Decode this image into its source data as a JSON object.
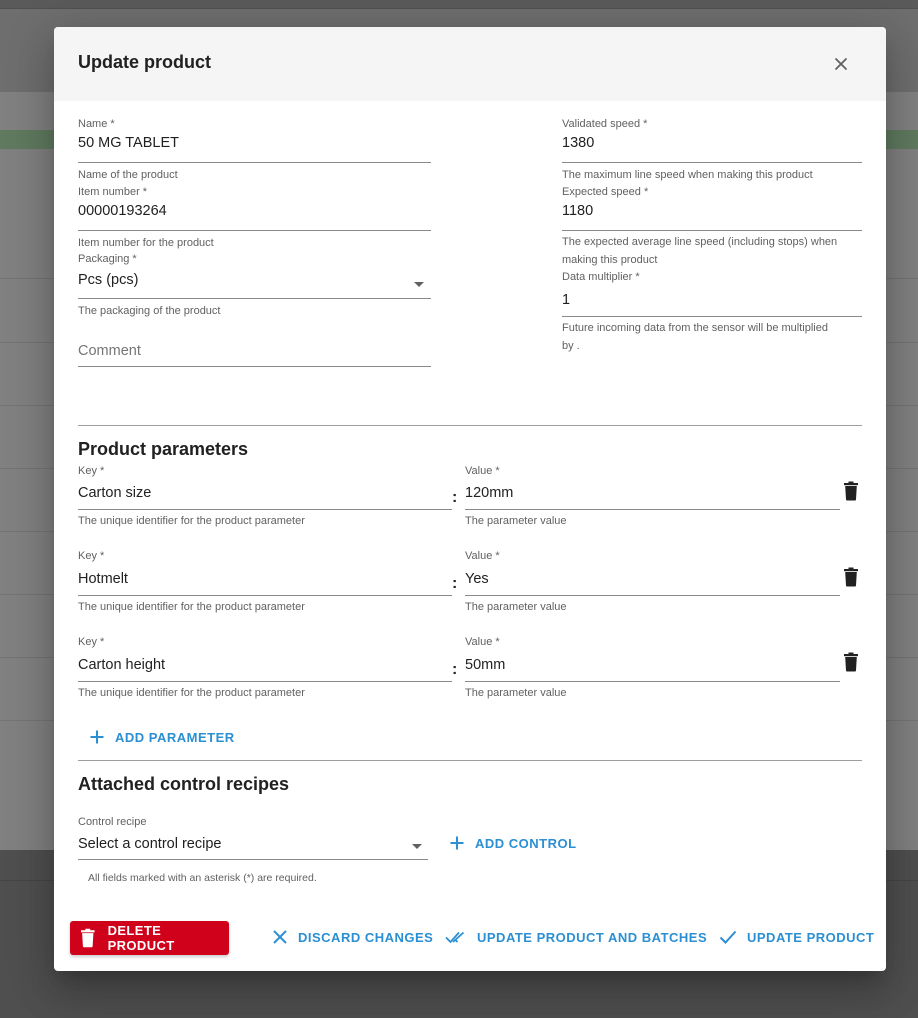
{
  "dialog": {
    "title": "Update product"
  },
  "product": {
    "name": {
      "label": "Name *",
      "value": "50 MG TABLET",
      "helper": "Name of the product"
    },
    "item_number": {
      "label": "Item number *",
      "value": "00000193264",
      "helper": "Item number for the product"
    },
    "packaging": {
      "label": "Packaging *",
      "value": "Pcs (pcs)",
      "helper": "The packaging of the product"
    },
    "comment": {
      "placeholder": "Comment",
      "value": ""
    },
    "validated_speed": {
      "label": "Validated speed *",
      "value": "1380",
      "helper": "The maximum line speed when making this product"
    },
    "expected_speed": {
      "label": "Expected speed *",
      "value": "1180",
      "helper_line1": "The expected average line speed (including stops) when",
      "helper_line2": "making this product"
    },
    "data_multiplier": {
      "label": "Data multiplier *",
      "value": "1",
      "helper_line1": "Future incoming data from the sensor will be multiplied",
      "helper_line2": "by ."
    }
  },
  "parameters": {
    "title": "Product parameters",
    "key_label": "Key *",
    "value_label": "Value *",
    "key_helper": "The unique identifier for the product parameter",
    "value_helper": "The parameter value",
    "separator": ":",
    "items": [
      {
        "key": "Carton size",
        "value": "120mm"
      },
      {
        "key": "Hotmelt",
        "value": "Yes"
      },
      {
        "key": "Carton height",
        "value": "50mm"
      }
    ],
    "add_label": "ADD PARAMETER"
  },
  "controls": {
    "title": "Attached control recipes",
    "recipe_label": "Control recipe",
    "recipe_value": "Select a control recipe",
    "add_label": "ADD CONTROL"
  },
  "footer": {
    "required_note": "All fields marked with an asterisk (*) are required.",
    "delete_label": "DELETE PRODUCT",
    "discard_label": "DISCARD CHANGES",
    "update_batches_label": "UPDATE PRODUCT AND BATCHES",
    "update_label": "UPDATE PRODUCT"
  },
  "colors": {
    "accent": "#2a8fd3",
    "danger": "#d0021b",
    "header_bg": "#f5f5f5"
  },
  "icons": [
    "close-icon",
    "chevron-down-icon",
    "trash-icon",
    "plus-icon",
    "x-icon",
    "double-check-icon",
    "check-icon"
  ]
}
